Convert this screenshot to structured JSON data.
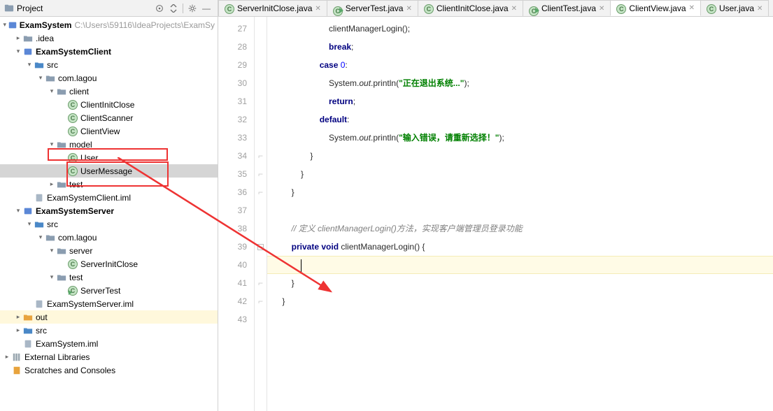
{
  "sidebar": {
    "title": "Project",
    "root": {
      "label": "ExamSystem",
      "path": "C:\\Users\\59116\\IdeaProjects\\ExamSy"
    },
    "idea_folder": ".idea",
    "client_module": "ExamSystemClient",
    "src": "src",
    "com_lagou": "com.lagou",
    "client_pkg": "client",
    "files": {
      "ClientInitClose": "ClientInitClose",
      "ClientScanner": "ClientScanner",
      "ClientView": "ClientView"
    },
    "model_pkg": "model",
    "model_files": {
      "User": "User",
      "UserMessage": "UserMessage"
    },
    "test_pkg": "test",
    "client_iml": "ExamSystemClient.iml",
    "server_module": "ExamSystemServer",
    "server_pkg": "server",
    "server_files": {
      "ServerInitClose": "ServerInitClose"
    },
    "server_test_pkg": "test",
    "server_test_files": {
      "ServerTest": "ServerTest"
    },
    "server_iml": "ExamSystemServer.iml",
    "out": "out",
    "root_src": "src",
    "root_iml": "ExamSystem.iml",
    "ext_lib": "External Libraries",
    "scratches": "Scratches and Consoles"
  },
  "tabs": [
    {
      "label": "ServerInitClose.java",
      "icon": "class"
    },
    {
      "label": "ServerTest.java",
      "icon": "runclass"
    },
    {
      "label": "ClientInitClose.java",
      "icon": "class"
    },
    {
      "label": "ClientTest.java",
      "icon": "runclass"
    },
    {
      "label": "ClientView.java",
      "icon": "class",
      "active": true
    },
    {
      "label": "User.java",
      "icon": "class"
    }
  ],
  "code": {
    "lines": [
      {
        "n": 27,
        "html": "                        clientManagerLogin();"
      },
      {
        "n": 28,
        "html": "                        <span class='kw'>break</span>;"
      },
      {
        "n": 29,
        "html": "                    <span class='kw'>case</span> <span class='num'>0</span>:"
      },
      {
        "n": 30,
        "html": "                        System.<span class='ital'>out</span>.println(<span class='str'>\"正在退出系统...\"</span>);"
      },
      {
        "n": 31,
        "html": "                        <span class='kw'>return</span>;"
      },
      {
        "n": 32,
        "html": "                    <span class='kw'>default</span>:"
      },
      {
        "n": 33,
        "html": "                        System.<span class='ital'>out</span>.println(<span class='str'>\"输入错误，请重新选择！\"</span>);"
      },
      {
        "n": 34,
        "html": "                }",
        "fold": "end"
      },
      {
        "n": 35,
        "html": "            }",
        "fold": "end"
      },
      {
        "n": 36,
        "html": "        }",
        "fold": "end"
      },
      {
        "n": 37,
        "html": ""
      },
      {
        "n": 38,
        "html": "        <span class='cm'>// 定义 clientManagerLogin()方法，实现客户端管理员登录功能</span>"
      },
      {
        "n": 39,
        "html": "        <span class='kw'>private void</span> clientManagerLogin() {",
        "fold": "start"
      },
      {
        "n": 40,
        "html": "            ",
        "current": true,
        "caret": true
      },
      {
        "n": 41,
        "html": "        }",
        "fold": "end"
      },
      {
        "n": 42,
        "html": "    }",
        "fold": "end"
      },
      {
        "n": 43,
        "html": ""
      }
    ]
  }
}
